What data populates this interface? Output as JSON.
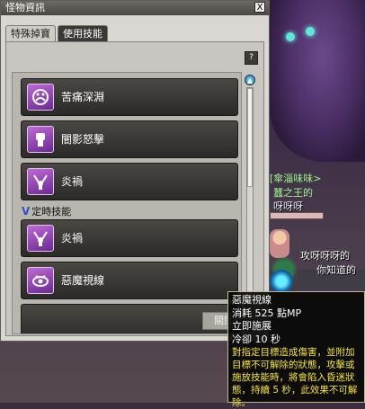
{
  "window": {
    "title": "怪物資訊",
    "close_label": "X",
    "help_label": "?"
  },
  "tabs": [
    {
      "label": "特殊掉寶",
      "active": false
    },
    {
      "label": "使用技能",
      "active": true
    }
  ],
  "skills": [
    {
      "name": "苦痛深淵",
      "icon": "tortured-face-icon"
    },
    {
      "name": "闇影怒擊",
      "icon": "raised-fist-icon"
    },
    {
      "name": "炎禍",
      "icon": "fire-arms-icon"
    },
    {
      "name": "炎禍",
      "icon": "fire-arms-icon"
    },
    {
      "name": "惡魔視線",
      "icon": "demon-eye-icon"
    }
  ],
  "section": {
    "label": "定時技能",
    "icon": "chevron-down-icon"
  },
  "scroll": {
    "up": "▲",
    "down": "▼"
  },
  "bottom_button": "關閉",
  "world": {
    "npc_name": "[傘淄味味>",
    "npc_title": "蠶之王的",
    "npc_line": "呀呀呀",
    "chat_1": "攻呀呀呀的",
    "chat_2": "你知道的"
  },
  "tooltip": {
    "name": "惡魔視線",
    "cost": "消耗 525 點MP",
    "cast": "立即施展",
    "cooldown": "冷卻 10 秒",
    "desc": "對指定目標造成傷害，並附加目標不可解除的狀態，攻擊或施放技能時，將會陷入昏迷狀態，持續 5 秒，此效果不可解除。"
  },
  "colors": {
    "tooltip_desc": "#f3e14a",
    "skill_icon": "#a24fc4",
    "world_green": "#9ff28a"
  }
}
